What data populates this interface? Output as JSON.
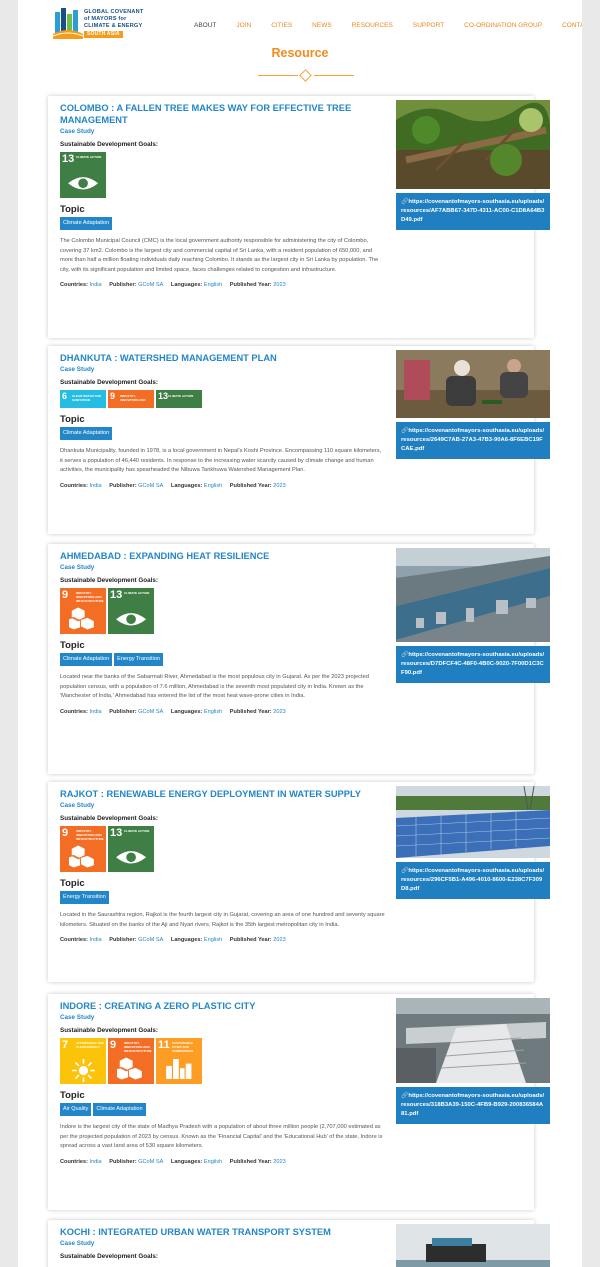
{
  "logo": {
    "lines": [
      "GLOBAL COVENANT",
      "of MAYORS for",
      "CLIMATE & ENERGY"
    ],
    "badge": "SOUTH ASIA"
  },
  "nav": [
    "ABOUT",
    "JOIN",
    "CITIES",
    "NEWS",
    "RESOURCES",
    "SUPPORT",
    "CO-ORDINATION GROUP",
    "CONTACT"
  ],
  "page_title": "Resource",
  "labels": {
    "sdg": "Sustainable Development Goals:",
    "topic": "Topic",
    "countries": "Countries:",
    "publisher": "Publisher:",
    "languages": "Languages:",
    "year": "Published Year:"
  },
  "cards": [
    {
      "title": "COLOMBO : A FALLEN TREE MAKES WAY FOR EFFECTIVE TREE MANAGEMENT",
      "type": "Case Study",
      "sdgs": [
        {
          "num": "13",
          "label": "CLIMATE ACTION",
          "color": "#3f7e44",
          "icon": "eye-globe-icon"
        }
      ],
      "topics": [
        "Climate Adaptation"
      ],
      "description": "The Colombo Municipal Council (CMC) is the local government authority responsible for administering the city of Colombo, covering 37 km2. Colombo is the largest city and commercial capital of Sri Lanka, with a resident population of 650,000, and more than half a million floating individuals daily reaching Colombo. It stands as the largest city in Sri Lanka by population. The city, with its significant population and limited space, faces challenges related to congestion and infrastructure.",
      "country": "India",
      "publisher": "GCoM SA",
      "language": "English",
      "year": "2023",
      "pdf": "https://covenantofmayors-southasia.eu/uploads/resources/AF7ABB67-347D-4311-AC00-C1D8A64B3D49.pdf",
      "image": "fallen-tree-photo"
    },
    {
      "title": "DHANKUTA : WATERSHED MANAGEMENT PLAN",
      "type": "Case Study",
      "sdgs": [
        {
          "num": "6",
          "label": "CLEAN WATER AND SANITATION",
          "color": "#26bde2",
          "icon": ""
        },
        {
          "num": "9",
          "label": "INDUSTRY, INNOVATION AND INFRASTRUCTURE",
          "color": "#f36d25",
          "icon": ""
        },
        {
          "num": "13",
          "label": "CLIMATE ACTION",
          "color": "#3f7e44",
          "icon": ""
        }
      ],
      "topics": [
        "Climate Adaptation"
      ],
      "description": "Dhankuta Municipality, founded in 1978, is a local government in Nepal's Koshi Province. Encompassing 110 square kilometers, it serves a population of 46,440 residents. In response to the increasing water scarcity caused by climate change and human activities, the municipality has spearheaded the Nibuwa Tankhuwa Watershed Management Plan.",
      "country": "India",
      "publisher": "GCoM SA",
      "language": "English",
      "year": "2023",
      "pdf": "https://covenantofmayors-southasia.eu/uploads/resources/2649C7AB-27A3-47B3-90A6-8F6EBC19FCAE.pdf",
      "image": "people-planting-photo"
    },
    {
      "title": "AHMEDABAD : EXPANDING HEAT RESILIENCE",
      "type": "Case Study",
      "sdgs": [
        {
          "num": "9",
          "label": "INDUSTRY, INNOVATION AND INFRASTRUCTURE",
          "color": "#f36d25",
          "icon": "cubes-icon"
        },
        {
          "num": "13",
          "label": "CLIMATE ACTION",
          "color": "#3f7e44",
          "icon": "eye-globe-icon"
        }
      ],
      "topics": [
        "Climate Adaptation",
        "Energy Transition"
      ],
      "description": "Located near the banks of the Sabarmati River, Ahmedabad is the most populous city in Gujarat. As per the 2023 projected population census, with a population of 7.6 million, Ahmedabad is the seventh most populated city in India. Known as the 'Manchester of India,' Ahmedabad has entered the list of the most heat wave-prone cities in India.",
      "country": "India",
      "publisher": "GCoM SA",
      "language": "English",
      "year": "2023",
      "pdf": "https://covenantofmayors-southasia.eu/uploads/resources/D7DFCF4C-48F0-4B0C-9020-7F00D1C3CF90.pdf",
      "image": "river-city-photo"
    },
    {
      "title": "RAJKOT : RENEWABLE ENERGY DEPLOYMENT IN WATER SUPPLY",
      "type": "Case Study",
      "sdgs": [
        {
          "num": "9",
          "label": "INDUSTRY, INNOVATION AND INFRASTRUCTURE",
          "color": "#f36d25",
          "icon": "cubes-icon"
        },
        {
          "num": "13",
          "label": "CLIMATE ACTION",
          "color": "#3f7e44",
          "icon": "eye-globe-icon"
        }
      ],
      "topics": [
        "Energy Transition"
      ],
      "description": "Located in the Saurashtra region, Rajkot is the fourth largest city in Gujarat, covering an area of one hundred and seventy square kilometers. Situated on the banks of the Aji and Nyari rivers, Rajkot is the 35th largest metropolitan city in India.",
      "country": "India",
      "publisher": "GCoM SA",
      "language": "English",
      "year": "2023",
      "pdf": "https://covenantofmayors-southasia.eu/uploads/resources/296CF5B1-A496-4010-8600-E238C7F309D8.pdf",
      "image": "solar-panels-photo"
    },
    {
      "title": "INDORE : CREATING A ZERO PLASTIC CITY",
      "type": "Case Study",
      "sdgs": [
        {
          "num": "7",
          "label": "AFFORDABLE AND CLEAN ENERGY",
          "color": "#fcc30b",
          "icon": "sun-icon"
        },
        {
          "num": "9",
          "label": "INDUSTRY, INNOVATION AND INFRASTRUCTURE",
          "color": "#f36d25",
          "icon": "cubes-icon"
        },
        {
          "num": "11",
          "label": "SUSTAINABLE CITIES AND COMMUNITIES",
          "color": "#fd9d24",
          "icon": "city-icon"
        }
      ],
      "topics": [
        "Air Quality",
        "Climate Adaptation"
      ],
      "description": "Indore is the largest city of the state of Madhya Pradesh with a population of about three million people (2,707,000 estimated as per the projected population of 2023 by census. Known as the 'Financial Capital' and the 'Educational Hub' of the state, Indore is spread across a vast land area of 530 square kilometers.",
      "country": "India",
      "publisher": "GCoM SA",
      "language": "English",
      "year": "2023",
      "pdf": "https://covenantofmayors-southasia.eu/uploads/resources/318B3A39-150C-4FB9-B929-200836584A81.pdf",
      "image": "plastic-facility-photo"
    },
    {
      "title": "KOCHI : INTEGRATED URBAN WATER TRANSPORT SYSTEM",
      "type": "Case Study",
      "sdgs": [],
      "topics": [],
      "description": "",
      "country": "",
      "publisher": "",
      "language": "",
      "year": "",
      "pdf": "",
      "image": "water-boat-photo"
    }
  ]
}
